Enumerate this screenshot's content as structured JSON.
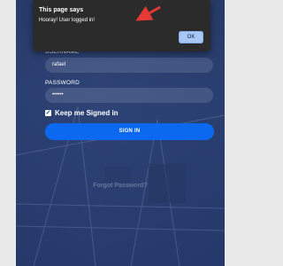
{
  "dialog": {
    "title": "This page says",
    "message": "Hooray! User logged in!",
    "ok_label": "OK"
  },
  "login": {
    "username_label": "USERNAME",
    "username_value": "rafael",
    "password_label": "PASSWORD",
    "password_value": "••••••",
    "remember_label": "Keep me Signed in",
    "signin_label": "SIGN IN",
    "forgot_label": "Forgot Password?"
  },
  "colors": {
    "page_background": "#e9e9e9",
    "panel_overlay": "#2a4076",
    "dialog_background": "#2b2b2b",
    "button_blue": "#0b69f0",
    "ok_button": "#a9c7f5",
    "annotation_arrow": "#e53935"
  },
  "icons": {
    "checkbox": "checkmark-icon",
    "annotation": "red-arrow-icon"
  }
}
